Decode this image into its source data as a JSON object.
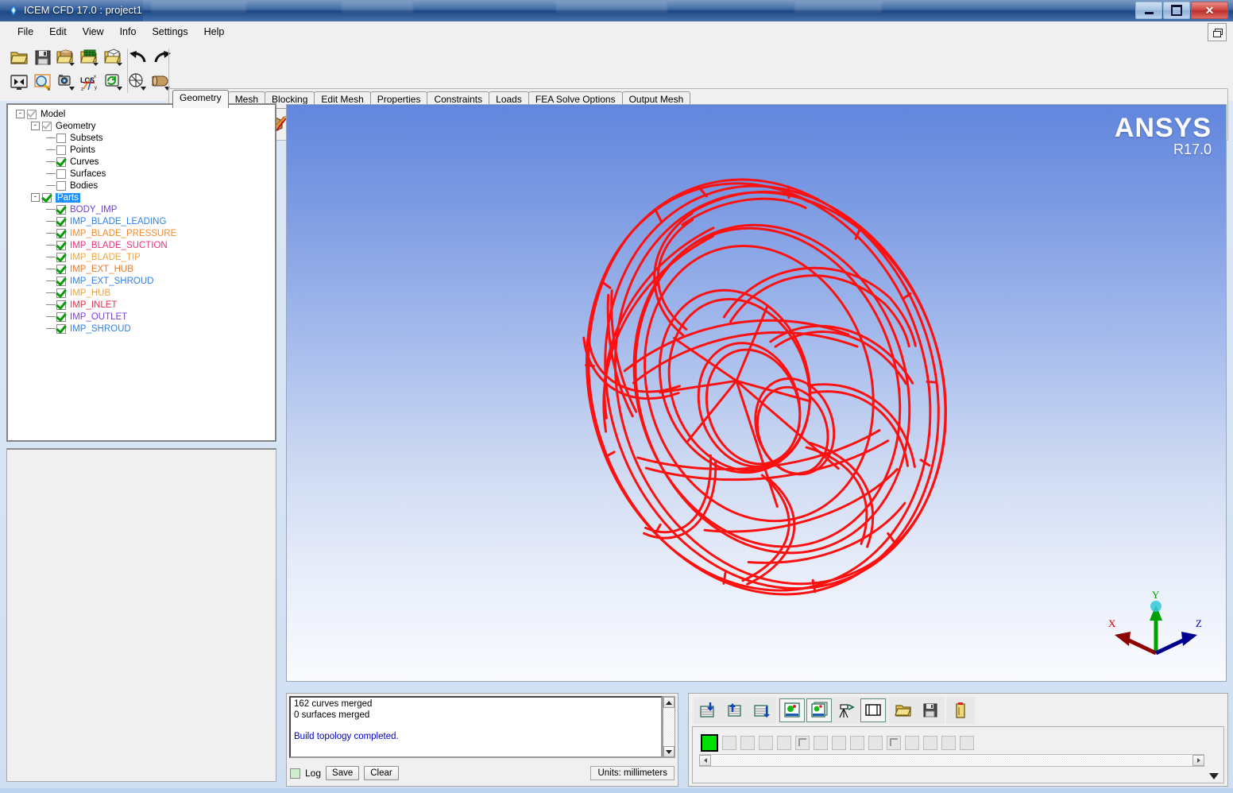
{
  "window": {
    "title": "ICEM CFD 17.0 : project1",
    "app_icon": "ansys-diamond-icon",
    "minimize": "minimize-icon",
    "maximize": "maximize-icon",
    "close": "✕"
  },
  "menubar": {
    "items": [
      "File",
      "Edit",
      "View",
      "Info",
      "Settings",
      "Help"
    ],
    "dock_button": "restore-window-icon"
  },
  "toolbar": {
    "file_row": [
      {
        "name": "open-project-icon",
        "tip": "Open Project"
      },
      {
        "name": "save-project-icon",
        "tip": "Save Project"
      },
      {
        "name": "open-geometry-icon",
        "tip": "Open Geometry"
      },
      {
        "name": "open-mesh-icon",
        "tip": "Open Mesh"
      },
      {
        "name": "open-blocking-icon",
        "tip": "Open Blocking"
      }
    ],
    "undo_row": [
      {
        "name": "undo-icon",
        "tip": "Undo"
      },
      {
        "name": "redo-icon",
        "tip": "Redo"
      }
    ],
    "view_row": [
      {
        "name": "fit-window-icon",
        "tip": "Fit Window"
      },
      {
        "name": "zoom-box-icon",
        "tip": "Zoom Box"
      },
      {
        "name": "saved-views-icon",
        "tip": "Saved Views"
      },
      {
        "name": "local-coordinate-system-icon",
        "tip": "LCS"
      },
      {
        "name": "refresh-display-icon",
        "tip": "Refresh"
      }
    ],
    "display_row": [
      {
        "name": "display-mode-icon",
        "tip": "Display Mode"
      },
      {
        "name": "solid-simple-display-icon",
        "tip": "Solid Simple Display"
      }
    ]
  },
  "tabs": {
    "items": [
      "Geometry",
      "Mesh",
      "Blocking",
      "Edit Mesh",
      "Properties",
      "Constraints",
      "Loads",
      "FEA Solve Options",
      "Output Mesh"
    ],
    "active": "Geometry"
  },
  "geometry_tools": [
    {
      "name": "create-point-icon",
      "tip": "Create Point"
    },
    {
      "name": "create-curve-icon",
      "tip": "Create/Modify Curve"
    },
    {
      "name": "create-surface-icon",
      "tip": "Create/Modify Surface"
    },
    {
      "name": "create-body-icon",
      "tip": "Create Body"
    },
    {
      "name": "repair-geometry-icon",
      "tip": "Repair Geometry"
    },
    {
      "name": "create-midsurface-icon",
      "tip": "Create Midsurface"
    },
    {
      "name": "transform-geometry-icon",
      "tip": "Transform Geometry"
    },
    {
      "name": "restore-dormant-entities-icon",
      "tip": "Restore Dormant Entities"
    },
    {
      "name": "delete-point-icon",
      "tip": "Delete Point"
    },
    {
      "name": "delete-curve-icon",
      "tip": "Delete Curve"
    },
    {
      "name": "delete-surface-icon",
      "tip": "Delete Surface"
    },
    {
      "name": "delete-body-icon",
      "tip": "Delete Body"
    },
    {
      "name": "delete-any-entity-icon",
      "tip": "Delete Any Entity"
    }
  ],
  "tree": {
    "nodes": [
      {
        "label": "Model",
        "depth": 0,
        "expander": "-",
        "check": "partial",
        "color": "#000000",
        "selected": false
      },
      {
        "label": "Geometry",
        "depth": 1,
        "expander": "-",
        "check": "partial",
        "color": "#000000",
        "selected": false
      },
      {
        "label": "Subsets",
        "depth": 2,
        "expander": "",
        "check": "off",
        "color": "#000000",
        "selected": false
      },
      {
        "label": "Points",
        "depth": 2,
        "expander": "",
        "check": "off",
        "color": "#000000",
        "selected": false
      },
      {
        "label": "Curves",
        "depth": 2,
        "expander": "",
        "check": "on",
        "color": "#000000",
        "selected": false
      },
      {
        "label": "Surfaces",
        "depth": 2,
        "expander": "",
        "check": "off",
        "color": "#000000",
        "selected": false
      },
      {
        "label": "Bodies",
        "depth": 2,
        "expander": "",
        "check": "off",
        "color": "#000000",
        "selected": false
      },
      {
        "label": "Parts",
        "depth": 1,
        "expander": "-",
        "check": "on",
        "color": "#000000",
        "selected": true
      },
      {
        "label": "BODY_IMP",
        "depth": 2,
        "expander": "",
        "check": "on",
        "color": "#6a3fd4",
        "selected": false
      },
      {
        "label": "IMP_BLADE_LEADING",
        "depth": 2,
        "expander": "",
        "check": "on",
        "color": "#2f7fe8",
        "selected": false
      },
      {
        "label": "IMP_BLADE_PRESSURE",
        "depth": 2,
        "expander": "",
        "check": "on",
        "color": "#f08b2a",
        "selected": false
      },
      {
        "label": "IMP_BLADE_SUCTION",
        "depth": 2,
        "expander": "",
        "check": "on",
        "color": "#ed2f7a",
        "selected": false
      },
      {
        "label": "IMP_BLADE_TIP",
        "depth": 2,
        "expander": "",
        "check": "on",
        "color": "#f0a33a",
        "selected": false
      },
      {
        "label": "IMP_EXT_HUB",
        "depth": 2,
        "expander": "",
        "check": "on",
        "color": "#f07722",
        "selected": false
      },
      {
        "label": "IMP_EXT_SHROUD",
        "depth": 2,
        "expander": "",
        "check": "on",
        "color": "#2f7fe8",
        "selected": false
      },
      {
        "label": "IMP_HUB",
        "depth": 2,
        "expander": "",
        "check": "on",
        "color": "#f0a03a",
        "selected": false
      },
      {
        "label": "IMP_INLET",
        "depth": 2,
        "expander": "",
        "check": "on",
        "color": "#ee2b4a",
        "selected": false
      },
      {
        "label": "IMP_OUTLET",
        "depth": 2,
        "expander": "",
        "check": "on",
        "color": "#7b3fd8",
        "selected": false
      },
      {
        "label": "IMP_SHROUD",
        "depth": 2,
        "expander": "",
        "check": "on",
        "color": "#2f7fe8",
        "selected": false
      }
    ]
  },
  "viewport": {
    "logo_main": "ANSYS",
    "logo_version": "R17.0",
    "background_top": "#6186dd",
    "background_bottom": "#fafbfe",
    "geometry_color": "#ff1010",
    "geometry_description": "centrifugal impeller wireframe curves",
    "triad": {
      "x_label": "X",
      "x_color": "#aa0000",
      "y_label": "Y",
      "y_color": "#00a000",
      "z_label": "Z",
      "z_color": "#0000cc"
    }
  },
  "messages": {
    "lines": [
      {
        "text": "162 curves merged",
        "color": "black"
      },
      {
        "text": "0 surfaces merged",
        "color": "black"
      },
      {
        "text": "",
        "color": "black"
      },
      {
        "text": "Build topology completed.",
        "color": "blue"
      }
    ],
    "log_label": "Log",
    "save_label": "Save",
    "clear_label": "Clear",
    "units_label": "Units: millimeters",
    "scroll_up": "scroll-up-arrow-icon",
    "scroll_down": "scroll-down-arrow-icon"
  },
  "right_panel": {
    "tools_group1": [
      {
        "name": "load-from-list-icon"
      },
      {
        "name": "save-to-list-icon"
      },
      {
        "name": "list-stack-icon"
      }
    ],
    "tools_group2": [
      {
        "name": "capture-screen-icon"
      },
      {
        "name": "capture-all-icon"
      },
      {
        "name": "camera-tripod-icon"
      },
      {
        "name": "frame-view-icon"
      }
    ],
    "tools_group3": [
      {
        "name": "open-file-icon"
      },
      {
        "name": "save-file-icon"
      }
    ],
    "tools_group4": [
      {
        "name": "delete-page-icon"
      }
    ],
    "chips": [
      {
        "state": "active"
      },
      {
        "state": "empty"
      },
      {
        "state": "empty"
      },
      {
        "state": "empty"
      },
      {
        "state": "empty"
      },
      {
        "state": "corner"
      },
      {
        "state": "empty"
      },
      {
        "state": "empty"
      },
      {
        "state": "empty"
      },
      {
        "state": "empty"
      },
      {
        "state": "corner"
      },
      {
        "state": "empty"
      },
      {
        "state": "empty"
      },
      {
        "state": "empty"
      },
      {
        "state": "empty"
      }
    ],
    "scroll_left": "scroll-left-arrow-icon",
    "scroll_right": "scroll-right-arrow-icon",
    "expand_down": "expand-down-arrow-icon"
  }
}
